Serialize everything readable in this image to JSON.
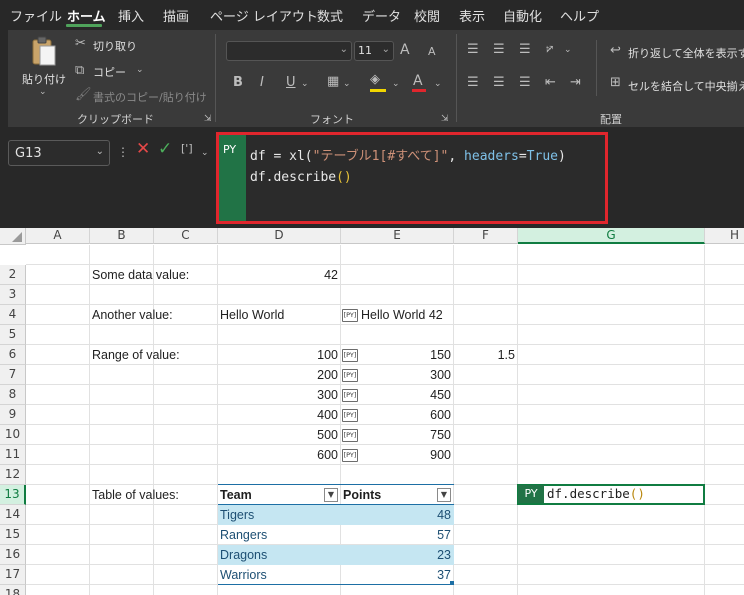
{
  "menu": {
    "items": [
      "ファイル",
      "ホーム",
      "挿入",
      "描画",
      "ページ レイアウト",
      "数式",
      "データ",
      "校閲",
      "表示",
      "自動化",
      "ヘルプ"
    ],
    "active": "ホーム"
  },
  "ribbon": {
    "clipboard": {
      "paste": "貼り付け",
      "cut": "切り取り",
      "copy": "コピー",
      "format_painter": "書式のコピー/貼り付け",
      "label": "クリップボード"
    },
    "font": {
      "size": "11",
      "bold": "B",
      "italic": "I",
      "underline": "U",
      "font_color_glyph": "A",
      "grow_glyph": "A",
      "shrink_glyph": "A",
      "label": "フォント"
    },
    "alignment": {
      "wrap": "折り返して全体を表示す",
      "merge": "セルを結合して中央揃え",
      "label": "配置"
    }
  },
  "formula_bar": {
    "name_box": "G13",
    "py_tag": "PY",
    "fx_glyph": "[']",
    "line1_a": "df = xl(",
    "line1_str": "\"テーブル1[#すべて]\"",
    "line1_b": ", ",
    "line1_kw": "headers",
    "line1_eq": "=",
    "line1_val": "True",
    "line1_c": ")",
    "line2_a": "df.describe",
    "line2_b": "()"
  },
  "sheet": {
    "columns": [
      "A",
      "B",
      "C",
      "D",
      "E",
      "F",
      "G",
      "H"
    ],
    "rows": [
      "2",
      "3",
      "4",
      "5",
      "6",
      "7",
      "8",
      "9",
      "10",
      "11",
      "12",
      "13",
      "14",
      "15",
      "16",
      "17",
      "18"
    ],
    "selected_column": "G",
    "selected_row": "13",
    "py_badge": "[PY]",
    "labels": {
      "some_data": "Some data value:",
      "another": "Another value:",
      "range": "Range of value:",
      "table": "Table of values:"
    },
    "some_data_value": "42",
    "another_d": "Hello World",
    "another_e": "Hello World 42",
    "range_d": [
      "100",
      "200",
      "300",
      "400",
      "500",
      "600"
    ],
    "range_e": [
      "150",
      "300",
      "450",
      "600",
      "750",
      "900"
    ],
    "range_f": "1.5",
    "table": {
      "headers": [
        "Team",
        "Points"
      ],
      "rows": [
        [
          "Tigers",
          "48"
        ],
        [
          "Rangers",
          "57"
        ],
        [
          "Dragons",
          "23"
        ],
        [
          "Warriors",
          "37"
        ]
      ]
    },
    "g13_py": "PY",
    "g13_code_a": "df.describe",
    "g13_code_b": "()"
  },
  "colors": {
    "accent": "#217346",
    "highlight": "#e0262d",
    "table_band": "#c5e6f2",
    "code_string": "#ce9178",
    "code_keyword": "#569cd6"
  }
}
